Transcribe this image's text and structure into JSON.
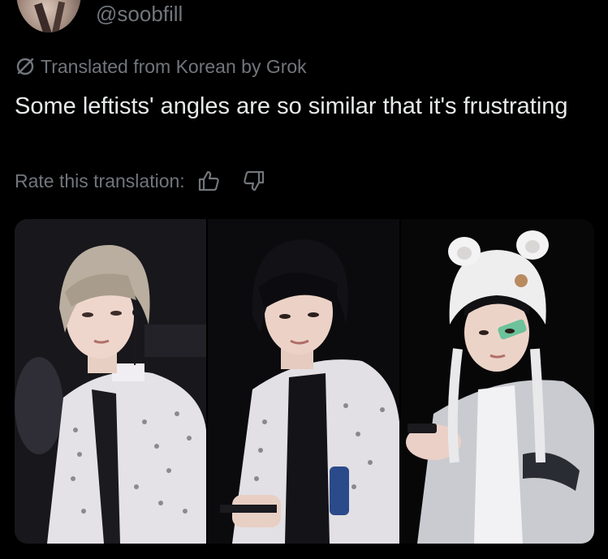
{
  "author": {
    "handle": "@soobfill"
  },
  "translation": {
    "icon": "translate-slash-icon",
    "label": "Translated from Korean by Grok"
  },
  "tweet": {
    "text": "Some leftists' angles are so similar that it's frustrating"
  },
  "rating": {
    "label": "Rate this translation:",
    "up_icon": "thumbs-up-icon",
    "down_icon": "thumbs-down-icon"
  },
  "colors": {
    "background": "#000000",
    "text_primary": "#e7e9ea",
    "text_secondary": "#71767b"
  },
  "media": {
    "photos": [
      {
        "name": "photo-1"
      },
      {
        "name": "photo-2"
      },
      {
        "name": "photo-3"
      }
    ]
  }
}
